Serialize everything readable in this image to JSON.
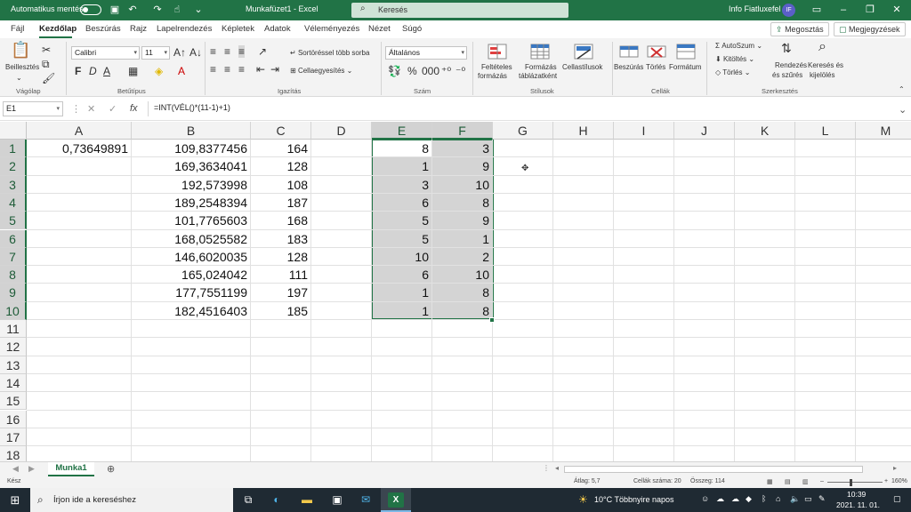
{
  "titlebar": {
    "autosave_label": "Automatikus mentés",
    "autosave_state": "off",
    "file_title": "Munkafüzet1 - Excel",
    "search_placeholder": "Keresés",
    "user_name": "Info Fiatluxefel",
    "avatar_initials": "IF"
  },
  "ribbon_tabs": [
    "Fájl",
    "Kezdőlap",
    "Beszúrás",
    "Rajz",
    "Lapelrendezés",
    "Képletek",
    "Adatok",
    "Véleményezés",
    "Nézet",
    "Súgó"
  ],
  "active_tab": "Kezdőlap",
  "share_label": "Megosztás",
  "comments_label": "Megjegyzések",
  "ribbon": {
    "clipboard": {
      "paste_label": "Beillesztés",
      "group_label": "Vágólap"
    },
    "font": {
      "name": "Calibri",
      "size": "11",
      "bold": "F",
      "italic": "D",
      "underline": "A",
      "group_label": "Betűtípus"
    },
    "alignment": {
      "wrap_label": "Sortöréssel több sorba",
      "merge_label": "Cellaegyesítés",
      "group_label": "Igazítás"
    },
    "number": {
      "format": "Általános",
      "group_label": "Szám"
    },
    "styles": {
      "conditional_label": [
        "Feltételes",
        "formázás"
      ],
      "table_label": [
        "Formázás",
        "táblázatként"
      ],
      "cellstyles_label": "Cellastílusok",
      "group_label": "Stílusok"
    },
    "cells": {
      "insert_label": "Beszúrás",
      "delete_label": "Törlés",
      "format_label": "Formátum",
      "group_label": "Cellák"
    },
    "editing": {
      "autosum_label": "AutoSzum",
      "fill_label": "Kitöltés",
      "clear_label": "Törlés",
      "sort_label": [
        "Rendezés",
        "és szűrés"
      ],
      "find_label": [
        "Keresés és",
        "kijelölés"
      ],
      "group_label": "Szerkesztés"
    }
  },
  "formula_bar": {
    "name_box": "E1",
    "formula": "=INT(VÉL()*(11-1)+1)"
  },
  "columns": [
    "A",
    "B",
    "C",
    "D",
    "E",
    "F",
    "G",
    "H",
    "I",
    "J",
    "K",
    "L",
    "M"
  ],
  "rows": [
    "1",
    "2",
    "3",
    "4",
    "5",
    "6",
    "7",
    "8",
    "9",
    "10",
    "11",
    "12",
    "13",
    "14",
    "15",
    "16",
    "17",
    "18"
  ],
  "cells": {
    "A": [
      "0,73649891",
      "",
      "",
      "",
      "",
      "",
      "",
      "",
      "",
      ""
    ],
    "B": [
      "109,8377456",
      "169,3634041",
      "192,573998",
      "189,2548394",
      "101,7765603",
      "168,0525582",
      "146,6020035",
      "165,024042",
      "177,7551199",
      "182,4516403"
    ],
    "C": [
      "164",
      "128",
      "108",
      "187",
      "168",
      "183",
      "128",
      "111",
      "197",
      "185"
    ],
    "E": [
      "8",
      "1",
      "3",
      "6",
      "5",
      "5",
      "10",
      "6",
      "1",
      "1"
    ],
    "F": [
      "3",
      "9",
      "10",
      "8",
      "9",
      "1",
      "2",
      "10",
      "8",
      "8"
    ]
  },
  "sheet_tab": "Munka1",
  "statusbar": {
    "ready": "Kész",
    "average": "Átlag: 5,7",
    "count": "Cellák száma: 20",
    "sum": "Összeg: 114",
    "zoom": "160%"
  },
  "taskbar": {
    "search_placeholder": "Írjon ide a kereséshez",
    "weather": "10°C  Többnyire napos",
    "time": "10:39",
    "date": "2021. 11. 01."
  }
}
